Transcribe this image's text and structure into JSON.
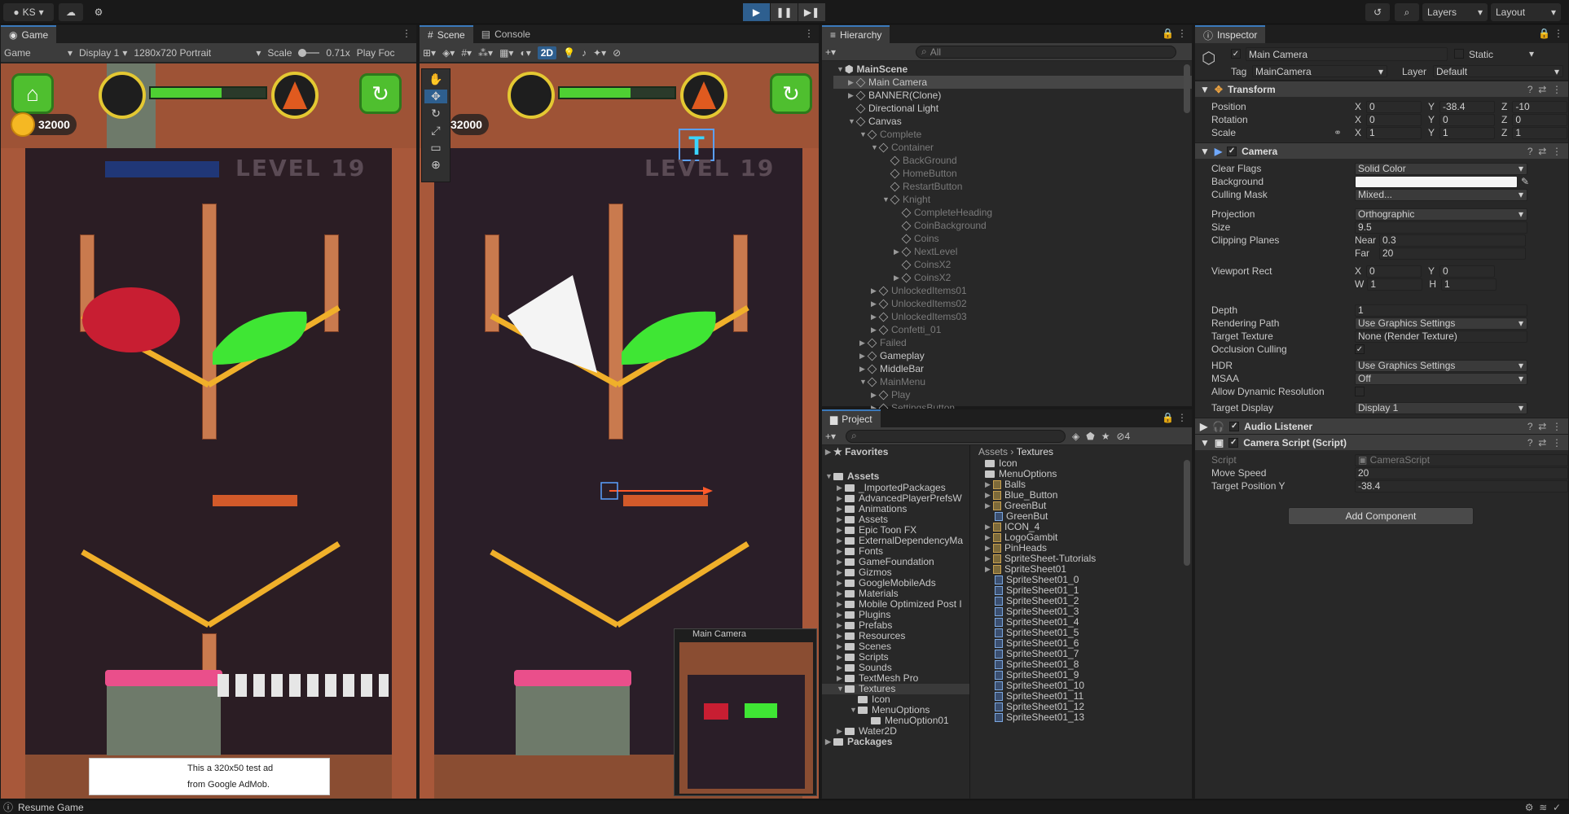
{
  "toolbar": {
    "account": "KS",
    "layers": "Layers",
    "layout": "Layout"
  },
  "game": {
    "tab": "Game",
    "mode": "Game",
    "display": "Display 1",
    "resolution": "1280x720 Portrait",
    "scale_label": "Scale",
    "scale_value": "0.71x",
    "play_focus": "Play Foc",
    "coins": "32000",
    "level": "LEVEL 19",
    "ad_text_1": "This a 320x50 test ad",
    "ad_text_2": "from Google AdMob."
  },
  "scene": {
    "tab": "Scene",
    "console_tab": "Console",
    "mode_2d": "2D",
    "camera_label": "Main Camera",
    "coins": "32000",
    "level": "LEVEL 19",
    "text_gizmo": "T"
  },
  "hierarchy": {
    "tab": "Hierarchy",
    "search_placeholder": "All",
    "items": [
      {
        "label": "MainScene",
        "indent": 0,
        "arrow": "▼",
        "dim": false,
        "scene": true
      },
      {
        "label": "Main Camera",
        "indent": 1,
        "arrow": "▶",
        "dim": false,
        "sel": true
      },
      {
        "label": "BANNER(Clone)",
        "indent": 1,
        "arrow": "▶",
        "dim": false
      },
      {
        "label": "Directional Light",
        "indent": 1,
        "arrow": "",
        "dim": false
      },
      {
        "label": "Canvas",
        "indent": 1,
        "arrow": "▼",
        "dim": false
      },
      {
        "label": "Complete",
        "indent": 2,
        "arrow": "▼",
        "dim": true
      },
      {
        "label": "Container",
        "indent": 3,
        "arrow": "▼",
        "dim": true
      },
      {
        "label": "BackGround",
        "indent": 4,
        "arrow": "",
        "dim": true
      },
      {
        "label": "HomeButton",
        "indent": 4,
        "arrow": "",
        "dim": true
      },
      {
        "label": "RestartButton",
        "indent": 4,
        "arrow": "",
        "dim": true
      },
      {
        "label": "Knight",
        "indent": 4,
        "arrow": "▼",
        "dim": true
      },
      {
        "label": "CompleteHeading",
        "indent": 5,
        "arrow": "",
        "dim": true
      },
      {
        "label": "CoinBackground",
        "indent": 5,
        "arrow": "",
        "dim": true
      },
      {
        "label": "Coins",
        "indent": 5,
        "arrow": "",
        "dim": true
      },
      {
        "label": "NextLevel",
        "indent": 5,
        "arrow": "▶",
        "dim": true
      },
      {
        "label": "CoinsX2",
        "indent": 5,
        "arrow": "",
        "dim": true
      },
      {
        "label": "CoinsX2",
        "indent": 5,
        "arrow": "▶",
        "dim": true
      },
      {
        "label": "UnlockedItems01",
        "indent": 3,
        "arrow": "▶",
        "dim": true
      },
      {
        "label": "UnlockedItems02",
        "indent": 3,
        "arrow": "▶",
        "dim": true
      },
      {
        "label": "UnlockedItems03",
        "indent": 3,
        "arrow": "▶",
        "dim": true
      },
      {
        "label": "Confetti_01",
        "indent": 3,
        "arrow": "▶",
        "dim": true
      },
      {
        "label": "Failed",
        "indent": 2,
        "arrow": "▶",
        "dim": true
      },
      {
        "label": "Gameplay",
        "indent": 2,
        "arrow": "▶",
        "dim": false
      },
      {
        "label": "MiddleBar",
        "indent": 2,
        "arrow": "▶",
        "dim": false
      },
      {
        "label": "MainMenu",
        "indent": 2,
        "arrow": "▼",
        "dim": true
      },
      {
        "label": "Play",
        "indent": 3,
        "arrow": "▶",
        "dim": true
      },
      {
        "label": "SettingsButton",
        "indent": 3,
        "arrow": "▶",
        "dim": true
      }
    ]
  },
  "project": {
    "tab": "Project",
    "favorites": "Favorites",
    "assets_root": "Assets",
    "breadcrumb_1": "Assets",
    "breadcrumb_2": "Textures",
    "hidden_count": "4",
    "tree": [
      "_ImportedPackages",
      "AdvancedPlayerPrefsW",
      "Animations",
      "Assets",
      "Epic Toon FX",
      "ExternalDependencyMa",
      "Fonts",
      "GameFoundation",
      "Gizmos",
      "GoogleMobileAds",
      "Materials",
      "Mobile Optimized Post I",
      "Plugins",
      "Prefabs",
      "Resources",
      "Scenes",
      "Scripts",
      "Sounds",
      "TextMesh Pro",
      "Textures",
      "Icon",
      "MenuOptions",
      "MenuOption01",
      "Water2D",
      "Packages"
    ],
    "files": [
      {
        "label": "Icon",
        "kind": "folder",
        "indent": 0
      },
      {
        "label": "MenuOptions",
        "kind": "folder",
        "indent": 0
      },
      {
        "label": "Balls",
        "kind": "img",
        "indent": 0
      },
      {
        "label": "Blue_Button",
        "kind": "img",
        "indent": 0
      },
      {
        "label": "GreenBut",
        "kind": "img",
        "indent": 0
      },
      {
        "label": "GreenBut",
        "kind": "spr",
        "indent": 1
      },
      {
        "label": "ICON_4",
        "kind": "img",
        "indent": 0
      },
      {
        "label": "LogoGambit",
        "kind": "img",
        "indent": 0
      },
      {
        "label": "PinHeads",
        "kind": "img",
        "indent": 0
      },
      {
        "label": "SpriteSheet-Tutorials",
        "kind": "img",
        "indent": 0
      },
      {
        "label": "SpriteSheet01",
        "kind": "img",
        "indent": 0
      },
      {
        "label": "SpriteSheet01_0",
        "kind": "spr",
        "indent": 1
      },
      {
        "label": "SpriteSheet01_1",
        "kind": "spr",
        "indent": 1
      },
      {
        "label": "SpriteSheet01_2",
        "kind": "spr",
        "indent": 1
      },
      {
        "label": "SpriteSheet01_3",
        "kind": "spr",
        "indent": 1
      },
      {
        "label": "SpriteSheet01_4",
        "kind": "spr",
        "indent": 1
      },
      {
        "label": "SpriteSheet01_5",
        "kind": "spr",
        "indent": 1
      },
      {
        "label": "SpriteSheet01_6",
        "kind": "spr",
        "indent": 1
      },
      {
        "label": "SpriteSheet01_7",
        "kind": "spr",
        "indent": 1
      },
      {
        "label": "SpriteSheet01_8",
        "kind": "spr",
        "indent": 1
      },
      {
        "label": "SpriteSheet01_9",
        "kind": "spr",
        "indent": 1
      },
      {
        "label": "SpriteSheet01_10",
        "kind": "spr",
        "indent": 1
      },
      {
        "label": "SpriteSheet01_11",
        "kind": "spr",
        "indent": 1
      },
      {
        "label": "SpriteSheet01_12",
        "kind": "spr",
        "indent": 1
      },
      {
        "label": "SpriteSheet01_13",
        "kind": "spr",
        "indent": 1
      }
    ]
  },
  "inspector": {
    "tab": "Inspector",
    "object_name": "Main Camera",
    "static": "Static",
    "tag_label": "Tag",
    "tag": "MainCamera",
    "layer_label": "Layer",
    "layer": "Default",
    "transform": {
      "title": "Transform",
      "position": "Position",
      "rotation": "Rotation",
      "scale": "Scale",
      "pos": [
        "0",
        "-38.4",
        "-10"
      ],
      "rot": [
        "0",
        "0",
        "0"
      ],
      "scl": [
        "1",
        "1",
        "1"
      ]
    },
    "camera": {
      "title": "Camera",
      "rows": [
        {
          "label": "Clear Flags",
          "value": "Solid Color",
          "kind": "dd"
        },
        {
          "label": "Background",
          "value": "",
          "kind": "color"
        },
        {
          "label": "Culling Mask",
          "value": "Mixed...",
          "kind": "dd"
        },
        {
          "label": "Projection",
          "value": "Orthographic",
          "kind": "dd"
        },
        {
          "label": "Size",
          "value": "9.5",
          "kind": "field"
        }
      ],
      "clipping": "Clipping Planes",
      "near_label": "Near",
      "near": "0.3",
      "far_label": "Far",
      "far": "20",
      "viewport": "Viewport Rect",
      "vx": "0",
      "vy": "0",
      "vw": "1",
      "vh": "1",
      "rows2": [
        {
          "label": "Depth",
          "value": "1",
          "kind": "field"
        },
        {
          "label": "Rendering Path",
          "value": "Use Graphics Settings",
          "kind": "dd"
        },
        {
          "label": "Target Texture",
          "value": "None (Render Texture)",
          "kind": "field"
        },
        {
          "label": "Occlusion Culling",
          "value": "✓",
          "kind": "chk"
        },
        {
          "label": "HDR",
          "value": "Use Graphics Settings",
          "kind": "dd"
        },
        {
          "label": "MSAA",
          "value": "Off",
          "kind": "dd"
        },
        {
          "label": "Allow Dynamic Resolution",
          "value": "",
          "kind": "chk"
        },
        {
          "label": "Target Display",
          "value": "Display 1",
          "kind": "dd"
        }
      ]
    },
    "audio": {
      "title": "Audio Listener"
    },
    "script": {
      "title": "Camera Script (Script)",
      "script_label": "Script",
      "script_value": "CameraScript",
      "move_label": "Move Speed",
      "move_value": "20",
      "target_label": "Target Position Y",
      "target_value": "-38.4"
    },
    "add_component": "Add Component"
  },
  "status": {
    "text": "Resume Game"
  },
  "colors": {
    "accent": "#3a79bb",
    "bg": "#282828",
    "header": "#3c3c3c"
  }
}
